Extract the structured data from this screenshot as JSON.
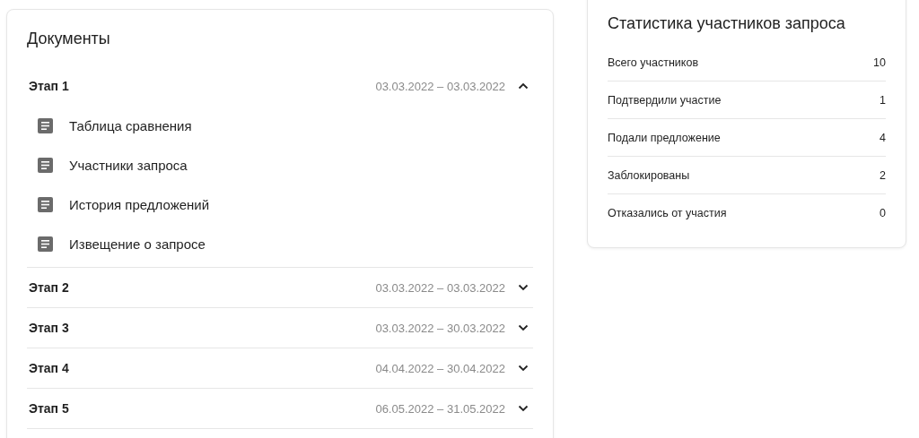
{
  "documents": {
    "title": "Документы",
    "stages": [
      {
        "label": "Этап 1",
        "dates": "03.03.2022 – 03.03.2022",
        "expanded": true,
        "children": [
          {
            "label": "Таблица сравнения"
          },
          {
            "label": "Участники запроса"
          },
          {
            "label": "История предложений"
          },
          {
            "label": "Извещение о запросе"
          }
        ]
      },
      {
        "label": "Этап 2",
        "dates": "03.03.2022 – 03.03.2022",
        "expanded": false
      },
      {
        "label": "Этап 3",
        "dates": "03.03.2022 – 30.03.2022",
        "expanded": false
      },
      {
        "label": "Этап 4",
        "dates": "04.04.2022 – 30.04.2022",
        "expanded": false
      },
      {
        "label": "Этап 5",
        "dates": "06.05.2022 – 31.05.2022",
        "expanded": false
      }
    ]
  },
  "statistics": {
    "title": "Статистика участников запроса",
    "rows": [
      {
        "label": "Всего участников",
        "value": "10"
      },
      {
        "label": "Подтвердили участие",
        "value": "1"
      },
      {
        "label": "Подали предложение",
        "value": "4"
      },
      {
        "label": "Заблокированы",
        "value": "2"
      },
      {
        "label": "Отказались от участия",
        "value": "0"
      }
    ]
  }
}
